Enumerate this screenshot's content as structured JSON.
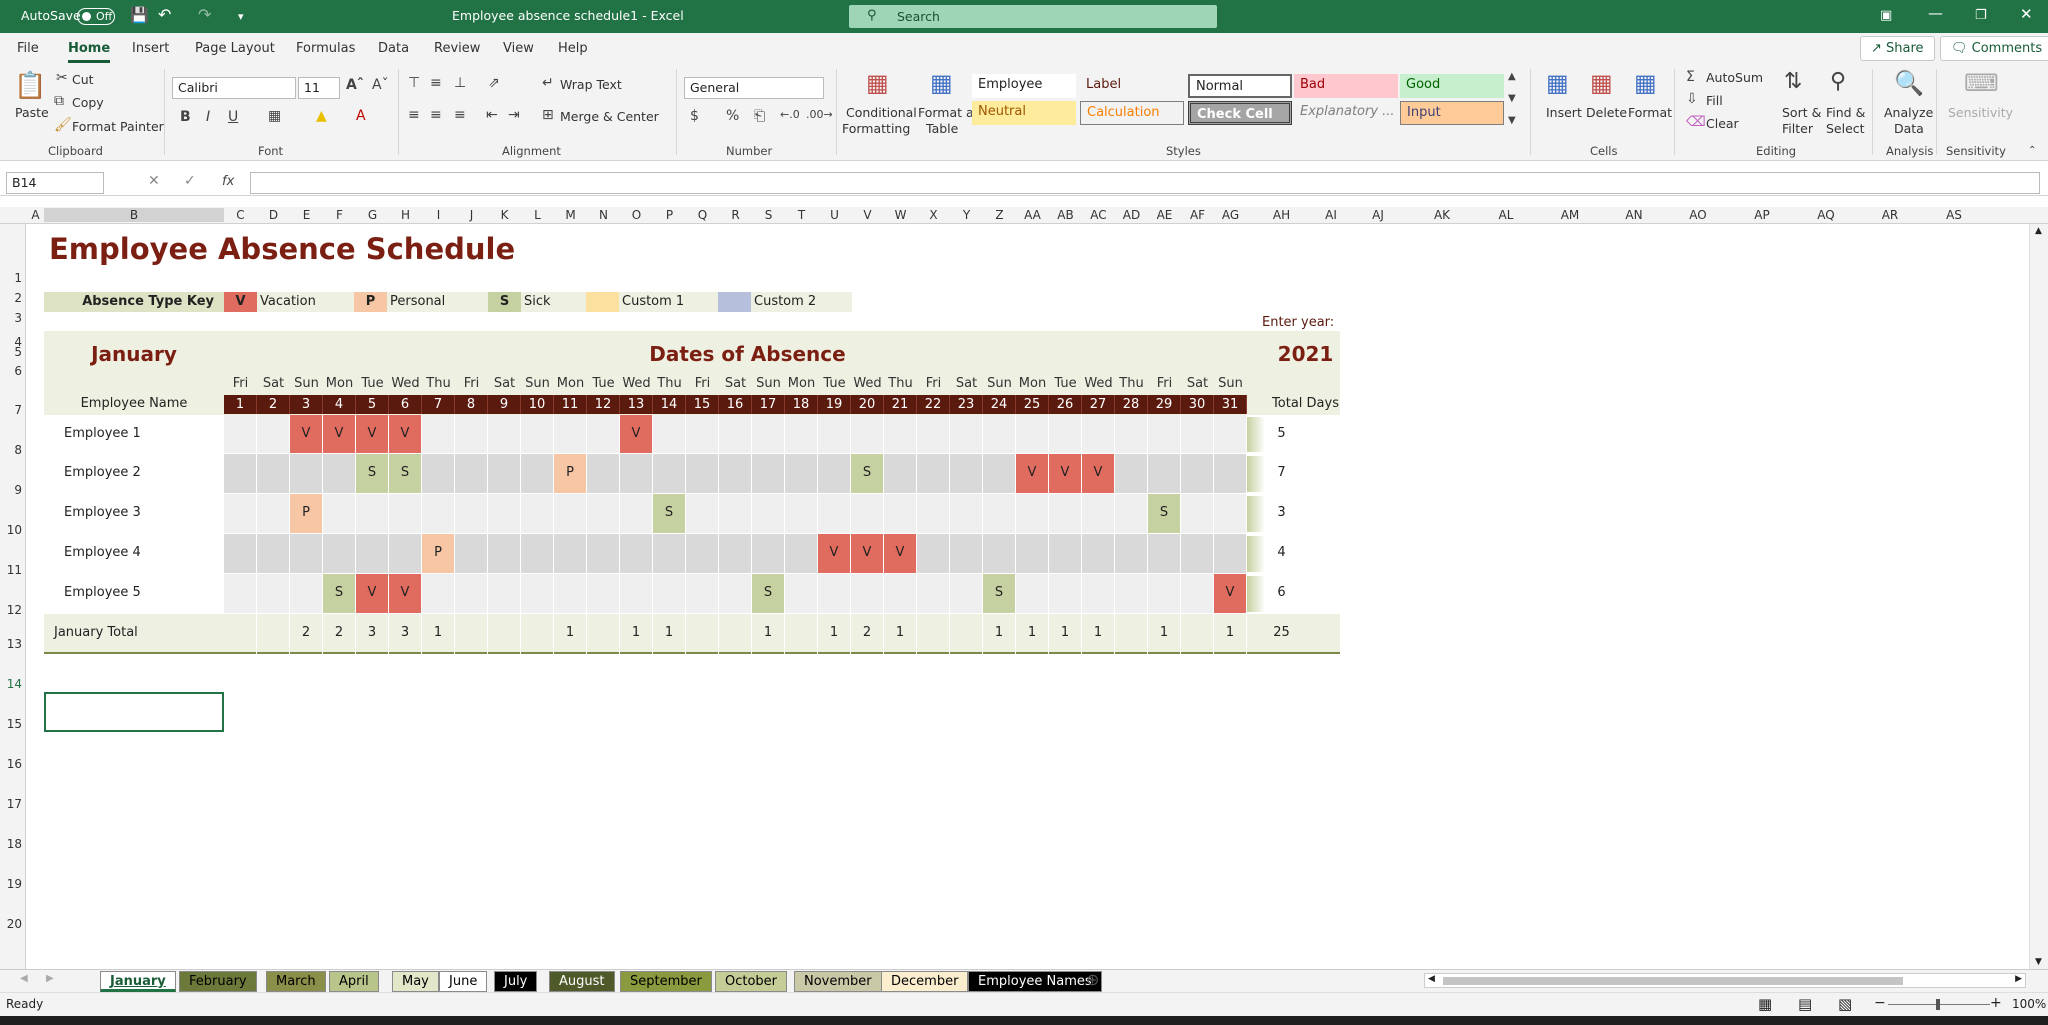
{
  "titlebar": {
    "autosave_label": "AutoSave",
    "autosave_state": "Off",
    "title": "Employee absence schedule1 - Excel",
    "search_placeholder": "Search"
  },
  "menus": [
    "File",
    "Home",
    "Insert",
    "Page Layout",
    "Formulas",
    "Data",
    "Review",
    "View",
    "Help"
  ],
  "actions": {
    "share": "Share",
    "comments": "Comments"
  },
  "ribbon": {
    "clipboard": {
      "paste": "Paste",
      "cut": "Cut",
      "copy": "Copy",
      "format_painter": "Format Painter",
      "group": "Clipboard"
    },
    "font": {
      "name": "Calibri",
      "size": "11",
      "group": "Font"
    },
    "alignment": {
      "wrap": "Wrap Text",
      "merge": "Merge & Center",
      "group": "Alignment"
    },
    "number": {
      "format": "General",
      "group": "Number"
    },
    "styles": {
      "conditional": "Conditional",
      "conditional2": "Formatting",
      "format_as": "Format as",
      "format_as2": "Table",
      "cells": [
        {
          "label": "Employee",
          "bg": "#ffffff",
          "fg": "#222222"
        },
        {
          "label": "Label",
          "bg": "#f3f3f3",
          "fg": "#5b1a0e"
        },
        {
          "label": "Normal",
          "bg": "#ffffff",
          "fg": "#222222"
        },
        {
          "label": "Bad",
          "bg": "#ffc7ce",
          "fg": "#9c0006"
        },
        {
          "label": "Good",
          "bg": "#c6efce",
          "fg": "#006100"
        },
        {
          "label": "Neutral",
          "bg": "#ffeb9c",
          "fg": "#9c5700"
        },
        {
          "label": "Calculation",
          "bg": "#f2f2f2",
          "fg": "#fa7d00"
        },
        {
          "label": "Check Cell",
          "bg": "#a5a5a5",
          "fg": "#ffffff"
        },
        {
          "label": "Explanatory ...",
          "bg": "#f3f3f3",
          "fg": "#7f7f7f"
        },
        {
          "label": "Input",
          "bg": "#ffcc99",
          "fg": "#3f3f76"
        }
      ],
      "group": "Styles"
    },
    "cells": {
      "insert": "Insert",
      "delete": "Delete",
      "format": "Format",
      "group": "Cells"
    },
    "editing": {
      "autosum": "AutoSum",
      "fill": "Fill",
      "clear": "Clear",
      "sort": "Sort &",
      "sort2": "Filter",
      "find": "Find &",
      "find2": "Select",
      "group": "Editing"
    },
    "analysis": {
      "analyze": "Analyze",
      "analyze2": "Data",
      "group": "Analysis"
    },
    "sensitivity": {
      "label": "Sensitivity",
      "group": "Sensitivity"
    }
  },
  "formula_bar": {
    "name_box": "B14",
    "fx": "fx",
    "value": ""
  },
  "columns": [
    "A",
    "B",
    "C",
    "D",
    "E",
    "F",
    "G",
    "H",
    "I",
    "J",
    "K",
    "L",
    "M",
    "N",
    "O",
    "P",
    "Q",
    "R",
    "S",
    "T",
    "U",
    "V",
    "W",
    "X",
    "Y",
    "Z",
    "AA",
    "AB",
    "AC",
    "AD",
    "AE",
    "AF",
    "AG",
    "AH",
    "AI",
    "AJ",
    "AK",
    "AL",
    "AM",
    "AN",
    "AO",
    "AP",
    "AQ",
    "AR",
    "AS"
  ],
  "rows": [
    "1",
    "2",
    "3",
    "4",
    "5",
    "6",
    "7",
    "8",
    "9",
    "10",
    "11",
    "12",
    "13",
    "14",
    "15",
    "16",
    "17",
    "18",
    "19",
    "20"
  ],
  "sheet": {
    "title": "Employee Absence Schedule",
    "key_label": "Absence Type Key",
    "key": [
      {
        "code": "V",
        "label": "Vacation",
        "color": "#e06c5f"
      },
      {
        "code": "P",
        "label": "Personal",
        "color": "#f7c7a5"
      },
      {
        "code": "S",
        "label": "Sick",
        "color": "#c5d1a0"
      },
      {
        "code": "",
        "label": "Custom 1",
        "color": "#fbe0a0"
      },
      {
        "code": "",
        "label": "Custom 2",
        "color": "#b6c0dc"
      }
    ],
    "enter_year_label": "Enter year:",
    "year": "2021",
    "month": "January",
    "dates_label": "Dates of Absence",
    "employee_name_header": "Employee Name",
    "total_days_header": "Total Days",
    "days_of_week": [
      "Fri",
      "Sat",
      "Sun",
      "Mon",
      "Tue",
      "Wed",
      "Thu",
      "Fri",
      "Sat",
      "Sun",
      "Mon",
      "Tue",
      "Wed",
      "Thu",
      "Fri",
      "Sat",
      "Sun",
      "Mon",
      "Tue",
      "Wed",
      "Thu",
      "Fri",
      "Sat",
      "Sun",
      "Mon",
      "Tue",
      "Wed",
      "Thu",
      "Fri",
      "Sat",
      "Sun"
    ],
    "dates": [
      "1",
      "2",
      "3",
      "4",
      "5",
      "6",
      "7",
      "8",
      "9",
      "10",
      "11",
      "12",
      "13",
      "14",
      "15",
      "16",
      "17",
      "18",
      "19",
      "20",
      "21",
      "22",
      "23",
      "24",
      "25",
      "26",
      "27",
      "28",
      "29",
      "30",
      "31"
    ],
    "employees": [
      {
        "name": "Employee 1",
        "absences": {
          "3": "V",
          "4": "V",
          "5": "V",
          "6": "V",
          "13": "V"
        },
        "total": "5"
      },
      {
        "name": "Employee 2",
        "absences": {
          "5": "S",
          "6": "S",
          "11": "P",
          "20": "S",
          "25": "V",
          "26": "V",
          "27": "V"
        },
        "total": "7"
      },
      {
        "name": "Employee 3",
        "absences": {
          "3": "P",
          "14": "S",
          "29": "S"
        },
        "total": "3"
      },
      {
        "name": "Employee 4",
        "absences": {
          "7": "P",
          "19": "V",
          "20": "V",
          "21": "V"
        },
        "total": "4"
      },
      {
        "name": "Employee 5",
        "absences": {
          "4": "S",
          "5": "V",
          "6": "V",
          "17": "S",
          "24": "S",
          "31": "V"
        },
        "total": "6"
      }
    ],
    "total_label": "January Total",
    "daily_totals": {
      "3": "2",
      "4": "2",
      "5": "3",
      "6": "3",
      "7": "1",
      "11": "1",
      "13": "1",
      "14": "1",
      "17": "1",
      "19": "1",
      "20": "2",
      "21": "1",
      "24": "1",
      "25": "1",
      "26": "1",
      "27": "1",
      "29": "1",
      "31": "1"
    },
    "grand_total": "25"
  },
  "tabs": [
    {
      "label": "January",
      "bg": "#ffffff",
      "fg": "#185c37",
      "active": true
    },
    {
      "label": "February",
      "bg": "#6b7a3b",
      "fg": "#000000"
    },
    {
      "label": "March",
      "bg": "#8a8f4a",
      "fg": "#000000"
    },
    {
      "label": "April",
      "bg": "#b7c48a",
      "fg": "#000000"
    },
    {
      "label": "May",
      "bg": "#e2e7c9",
      "fg": "#000000"
    },
    {
      "label": "June",
      "bg": "#ffffff",
      "fg": "#000000"
    },
    {
      "label": "July",
      "bg": "#000000",
      "fg": "#ffffff"
    },
    {
      "label": "August",
      "bg": "#4e5a2a",
      "fg": "#ffffff"
    },
    {
      "label": "September",
      "bg": "#8a9a3f",
      "fg": "#000000"
    },
    {
      "label": "October",
      "bg": "#c5cc95",
      "fg": "#000000"
    },
    {
      "label": "November",
      "bg": "#c9c9a8",
      "fg": "#000000"
    },
    {
      "label": "December",
      "bg": "#fbeecf",
      "fg": "#000000"
    },
    {
      "label": "Employee Names",
      "bg": "#000000",
      "fg": "#ffffff"
    }
  ],
  "status": {
    "ready": "Ready",
    "zoom": "100%"
  }
}
